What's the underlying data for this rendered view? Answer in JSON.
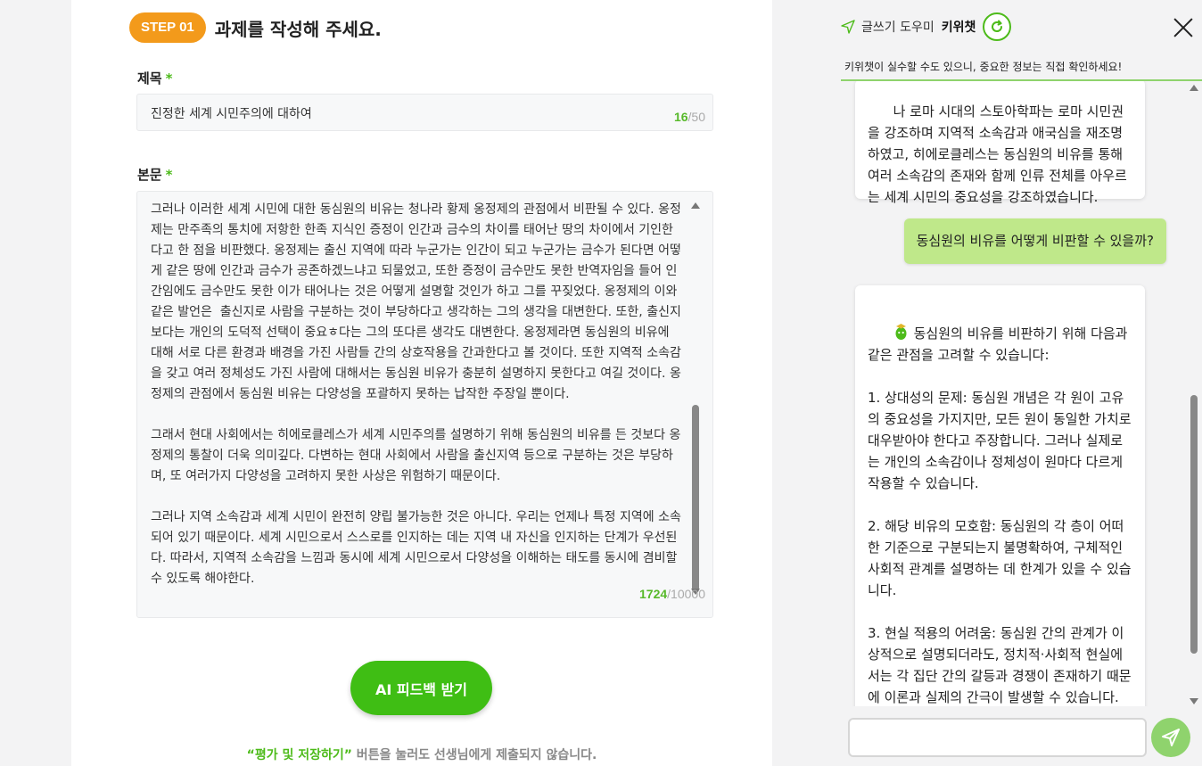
{
  "editor": {
    "step_badge": "STEP 01",
    "step_title": "과제를 작성해 주세요.",
    "title_label": "제목",
    "required_mark": "*",
    "title_value": "진정한 세계 시민주의에 대하여",
    "title_count": "16",
    "title_max": "/50",
    "body_label": "본문",
    "body_value": "그러나 이러한 세계 시민에 대한 동심원의 비유는 청나라 황제 옹정제의 관점에서 비판될 수 있다. 옹정제는 만주족의 통치에 저항한 한족 지식인 증정이 인간과 금수의 차이를 태어난 땅의 차이에서 기인한다고 한 점을 비판했다. 옹정제는 출신 지역에 따라 누군가는 인간이 되고 누군가는 금수가 된다면 어떻게 같은 땅에 인간과 금수가 공존하겠느냐고 되물었고, 또한 증정이 금수만도 못한 반역자임을 들어 인간임에도 금수만도 못한 이가 태어나는 것은 어떻게 설명할 것인가 하고 그를 꾸짖었다. 옹정제의 이와 같은 발언은  출신지로 사람을 구분하는 것이 부당하다고 생각하는 그의 생각을 대변한다. 또한, 출신지보다는 개인의 도덕적 선택이 중요ㅎ다는 그의 또다른 생각도 대변한다. 옹정제라면 동심원의 비유에 대해 서로 다른 환경과 배경을 가진 사람들 간의 상호작용을 간과한다고 볼 것이다. 또한 지역적 소속감을 갖고 여러 정체성도 가진 사람에 대해서는 동심원 비유가 충분히 설명하지 못한다고 여길 것이다. 옹정제의 관점에서 동심원 비유는 다양성을 포괄하지 못하는 납작한 주장일 뿐이다.\n\n그래서 현대 사회에서는 히에로클레스가 세계 시민주의를 설명하기 위해 동심원의 비유를 든 것보다 옹정제의 통찰이 더욱 의미깊다. 다변하는 현대 사회에서 사람을 출신지역 등으로 구분하는 것은 부당하며, 또 여러가지 다양성을 고려하지 못한 사상은 위험하기 때문이다.\n\n그러나 지역 소속감과 세계 시민이 완전히 양립 불가능한 것은 아니다. 우리는 언제나 특정 지역에 소속되어 있기 때문이다. 세계 시민으로서 스스로를 인지하는 데는 지역 내 자신을 인지하는 단계가 우선된다. 따라서, 지역적 소속감을 느낌과 동시에 세계 시민으로서 다양성을 이해하는 태도를 동시에 겸비할 수 있도록 해야한다.",
    "body_count": "1724",
    "body_max": "/10000",
    "ai_button": "AI 피드백 받기",
    "notice_highlight": "“평가 및 저장하기”",
    "notice_rest": " 버튼을 눌러도 선생님에게 제출되지 않습니다."
  },
  "chat": {
    "header_title": "글쓰기 도우미",
    "header_name": "키위챗",
    "warning": "키위챗이 실수할 수도 있으니, 중요한 정보는 직접 확인하세요!",
    "messages": {
      "bot1": "나 로마 시대의 스토아학파는 로마 시민권을 강조하며 지역적 소속감과 애국심을 재조명하였고, 히에로클레스는 동심원의 비유를 통해 여러 소속감의 존재와 함께 인류 전체를 아우르는 세계 시민의 중요성을 강조하였습니다.",
      "user1": "동심원의 비유를 어떻게 비판할 수 있을까?",
      "bot2": "동심원의 비유를 비판하기 위해 다음과 같은 관점을 고려할 수 있습니다:\n\n1. 상대성의 문제: 동심원 개념은 각 원이 고유의 중요성을 가지지만, 모든 원이 동일한 가치로 대우받아야 한다고 주장합니다. 그러나 실제로는 개인의 소속감이나 정체성이 원마다 다르게 작용할 수 있습니다.\n\n2. 해당 비유의 모호함: 동심원의 각 층이 어떠한 기준으로 구분되는지 불명확하여, 구체적인 사회적 관계를 설명하는 데 한계가 있을 수 있습니다.\n\n3. 현실 적용의 어려움: 동심원 간의 관계가 이상적으로 설명되더라도, 정치적·사회적 현실에서는 각 집단 간의 갈등과 경쟁이 존재하기 때문에 이론과 실제의 간극이 발생할 수 있습니다."
    },
    "input_placeholder": ""
  },
  "colors": {
    "accent_green": "#3fbe14",
    "step_orange": "#f39a1b",
    "user_bubble": "#bfe88a"
  },
  "icons": [
    "send-icon",
    "refresh-icon",
    "close-icon",
    "scroll-up-icon",
    "scroll-down-icon",
    "bot-avatar-icon"
  ]
}
